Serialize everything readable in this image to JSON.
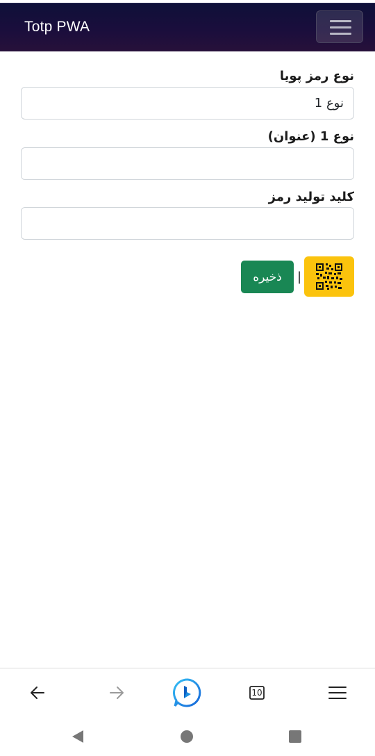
{
  "navbar": {
    "brand": "Totp PWA",
    "toggler_icon": "hamburger-icon"
  },
  "form": {
    "type_label": "نوع رمز پویا",
    "type_value": "نوع 1",
    "title_label": "نوع 1 (عنوان)",
    "title_value": "",
    "key_label": "کلید تولید رمز",
    "key_value": ""
  },
  "actions": {
    "qr_icon": "qr-code-icon",
    "divider": "|",
    "save_label": "ذخیره"
  },
  "browser_toolbar": {
    "back_icon": "arrow-left-icon",
    "forward_icon": "arrow-right-icon",
    "bing_icon": "bing-chat-icon",
    "tabs_count": "10",
    "menu_icon": "menu-icon"
  },
  "system_nav": {
    "back_icon": "triangle-back-icon",
    "home_icon": "circle-home-icon",
    "recents_icon": "square-recents-icon"
  },
  "colors": {
    "navbar_bg": "#130f3a",
    "qr_button_bg": "#fbc30d",
    "save_button_bg": "#198754",
    "bing_blue": "#1b8fe0"
  }
}
